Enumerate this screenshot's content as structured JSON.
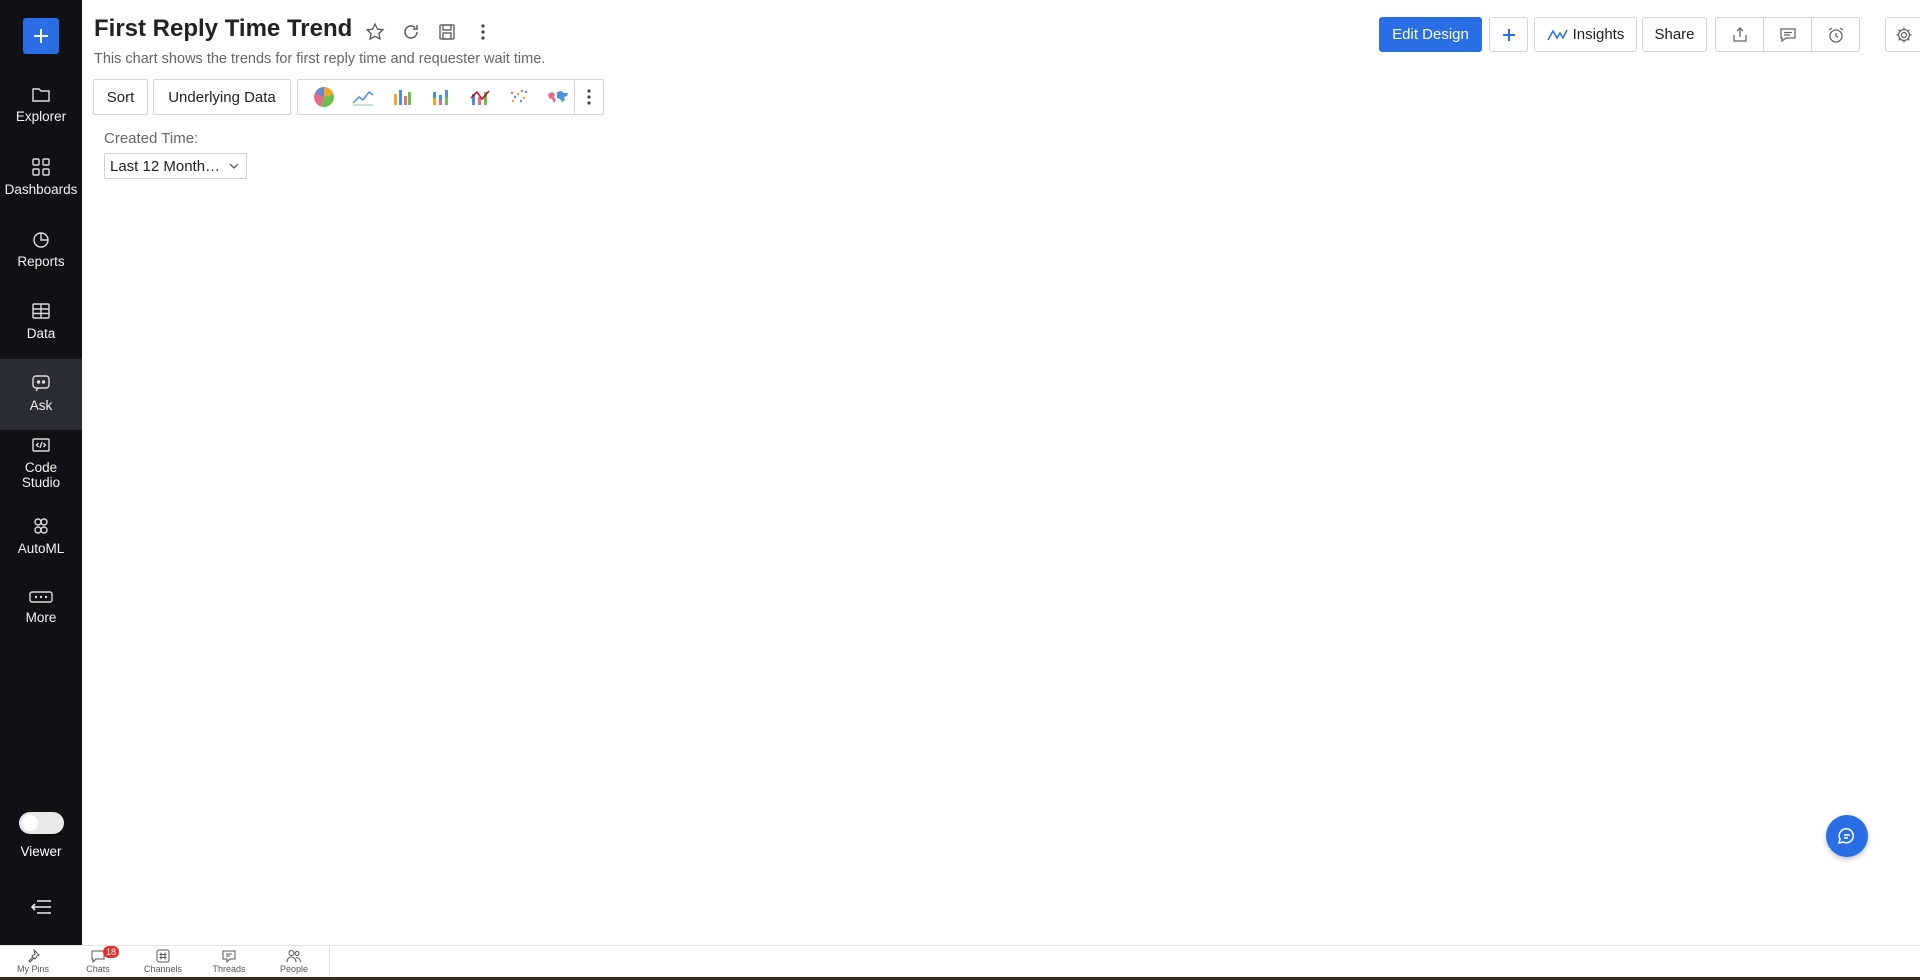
{
  "sidebar": {
    "items": [
      {
        "label": "Explorer"
      },
      {
        "label": "Dashboards"
      },
      {
        "label": "Reports"
      },
      {
        "label": "Data"
      },
      {
        "label": "Ask"
      },
      {
        "label": "Code Studio"
      },
      {
        "label": "AutoML"
      },
      {
        "label": "More"
      }
    ],
    "viewer_label": "Viewer"
  },
  "header": {
    "title": "First Reply Time Trend",
    "subtitle": "This chart shows the trends for first reply time and requester wait time."
  },
  "toolbar": {
    "sort_label": "Sort",
    "underlying_label": "Underlying Data"
  },
  "filter": {
    "label": "Created Time:",
    "value": "Last 12 Month…"
  },
  "actions": {
    "edit_design_label": "Edit Design",
    "insights_label": "Insights",
    "share_label": "Share"
  },
  "bottombar": {
    "items": [
      {
        "label": "My Pins"
      },
      {
        "label": "Chats",
        "badge": "18"
      },
      {
        "label": "Channels"
      },
      {
        "label": "Threads"
      },
      {
        "label": "People"
      }
    ]
  },
  "colors": {
    "accent": "#2a6ee5",
    "sidebar_bg": "#0f1115",
    "badge": "#e53030"
  }
}
